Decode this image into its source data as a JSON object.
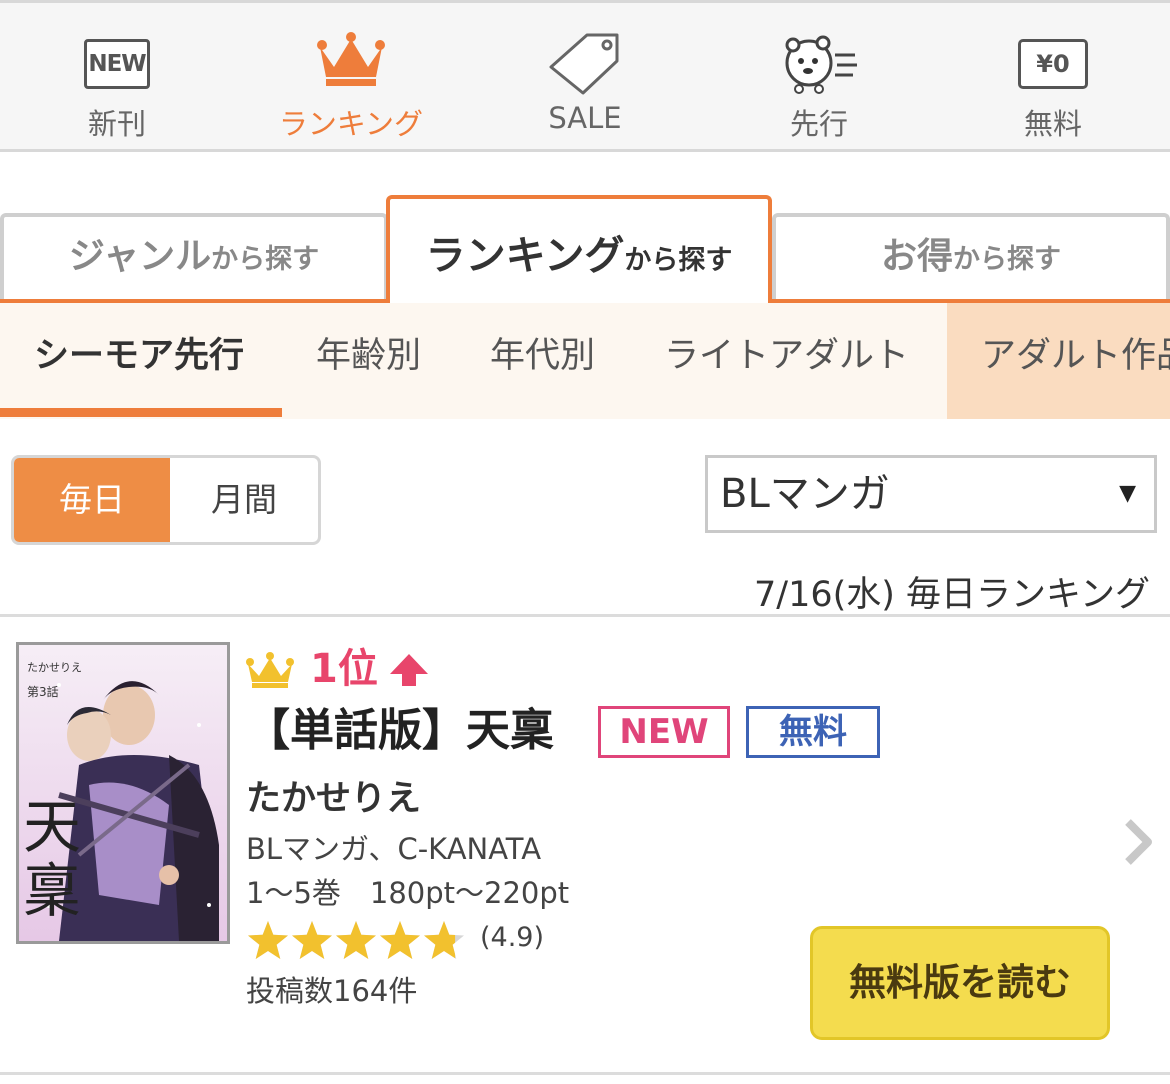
{
  "nav": {
    "new_icon_text": "NEW",
    "new_label": "新刊",
    "ranking_label": "ランキング",
    "sale_label": "SALE",
    "advance_label": "先行",
    "free_icon_text": "¥0",
    "free_label": "無料",
    "active_color": "#ee7d3b"
  },
  "category_tabs": [
    {
      "main": "ジャンル",
      "suffix": "から探す",
      "active": false
    },
    {
      "main": "ランキング",
      "suffix": "から探す",
      "active": true
    },
    {
      "main": "お得",
      "suffix": "から探す",
      "active": false
    }
  ],
  "sub_tabs": [
    "シーモア先行",
    "年齢別",
    "年代別",
    "ライトアダルト",
    "アダルト作品"
  ],
  "period": {
    "daily": "毎日",
    "monthly": "月間"
  },
  "genre_select": {
    "value": "BLマンガ"
  },
  "ranking_date": "7/16(水) 毎日ランキング",
  "item": {
    "rank": "1位",
    "title": "【単話版】天稟",
    "badge_new": "NEW",
    "badge_free": "無料",
    "author": "たかせりえ",
    "genre": "BLマンガ、C-KANATA",
    "volumes": "1〜5巻　180pt〜220pt",
    "rating": "(4.9)",
    "rating_value": 4.9,
    "posts": "投稿数164件",
    "read_button": "無料版を読む",
    "cover": {
      "author": "たかせりえ",
      "episode": "第3話",
      "title_chars": [
        "天",
        "稟"
      ]
    }
  },
  "colors": {
    "accent": "#ee7d3b",
    "rank_pink": "#e8456b",
    "badge_new": "#e0457a",
    "badge_free": "#3d63b5",
    "button_yellow": "#f4dc4e",
    "star": "#f2c12e"
  }
}
